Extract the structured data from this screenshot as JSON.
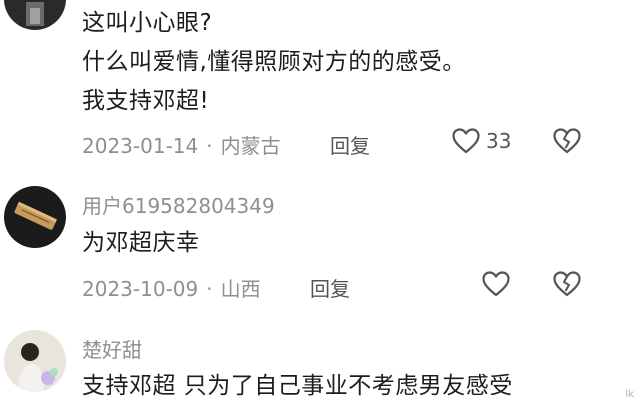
{
  "comments": [
    {
      "lines": [
        "这叫小心眼?",
        "什么叫爱情,懂得照顾对方的的感受。",
        "我支持邓超!"
      ],
      "date": "2023-01-14",
      "location": "内蒙古",
      "reply_label": "回复",
      "likes": "33"
    },
    {
      "username": "用户619582804349",
      "lines": [
        "为邓超庆幸"
      ],
      "date": "2023-10-09",
      "location": "山西",
      "reply_label": "回复"
    },
    {
      "username": "楚好甜",
      "lines": [
        "支持邓超 只为了自己事业不考虑男友感受"
      ]
    }
  ],
  "separator": "·",
  "icons": {
    "like": "heart-outline-icon",
    "dislike": "broken-heart-icon"
  },
  "watermark": "lk",
  "colors": {
    "text": "#1c1c1c",
    "meta": "#8f8f8f",
    "icon": "#555555"
  }
}
